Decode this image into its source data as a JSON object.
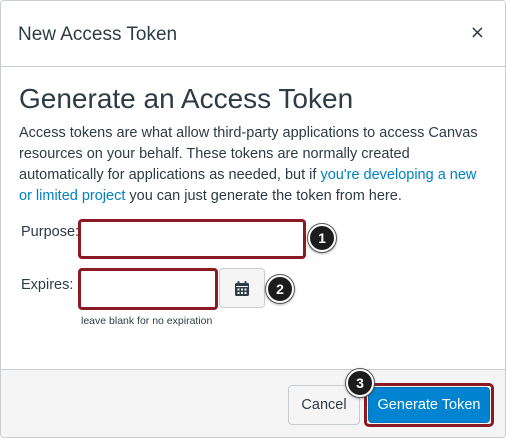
{
  "dialog": {
    "title": "New Access Token",
    "close_glyph": "×"
  },
  "content": {
    "heading": "Generate an Access Token",
    "description_before_link": "Access tokens are what allow third-party applications to access Canvas resources on your behalf. These tokens are normally created automatically for applications as needed, but if ",
    "description_link": "you're developing a new or limited project",
    "description_after_link": " you can just generate the token from here."
  },
  "form": {
    "purpose_label": "Purpose:",
    "purpose_value": "",
    "expires_label": "Expires:",
    "expires_value": "",
    "expires_hint": "leave blank for no expiration",
    "calendar_icon": "calendar-icon"
  },
  "callouts": [
    "1",
    "2",
    "3"
  ],
  "footer": {
    "cancel_label": "Cancel",
    "generate_label": "Generate Token"
  },
  "colors": {
    "primary": "#0084d1",
    "link": "#0081bd",
    "highlight_border": "#8b1a22",
    "text": "#2d3b45"
  }
}
